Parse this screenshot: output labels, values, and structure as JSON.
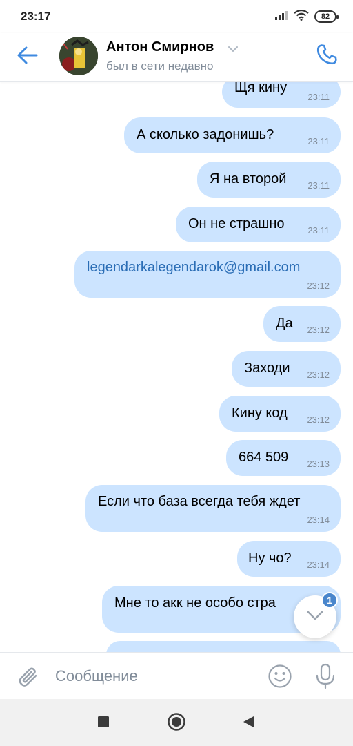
{
  "status_bar": {
    "time": "23:17",
    "battery": "82"
  },
  "header": {
    "contact_name": "Антон Смирнов",
    "contact_status": "был в сети недавно"
  },
  "messages": [
    {
      "text": "Щя кину",
      "time": "23:11"
    },
    {
      "text": "А сколько задонишь?",
      "time": "23:11"
    },
    {
      "text": "Я на второй",
      "time": "23:11"
    },
    {
      "text": "Он не страшно",
      "time": "23:11"
    },
    {
      "text": "legendarkalegendarok@gmail.com",
      "time": "23:12",
      "is_link": true
    },
    {
      "text": "Да",
      "time": "23:12"
    },
    {
      "text": "Заходи",
      "time": "23:12"
    },
    {
      "text": "Кину код",
      "time": "23:12"
    },
    {
      "text": "664 509",
      "time": "23:13"
    },
    {
      "text": "Если что база всегда тебя ждет",
      "time": "23:14"
    },
    {
      "text": "Ну чо?",
      "time": "23:14"
    },
    {
      "text": "Мне то акк не особо стра",
      "time": ""
    }
  ],
  "scroll_down": {
    "unread_count": "1"
  },
  "composer": {
    "placeholder": "Сообщение"
  },
  "icons": {
    "back": "arrow-left-icon",
    "call": "phone-icon",
    "attach": "paperclip-icon",
    "emoji": "smile-icon",
    "mic": "microphone-icon",
    "scroll_down": "chevron-down-icon"
  },
  "colors": {
    "accent": "#3f8ae0",
    "bubble_outgoing": "#cce4ff",
    "secondary_text": "#818c99",
    "badge": "#4986cc",
    "link": "#2a6db5"
  }
}
